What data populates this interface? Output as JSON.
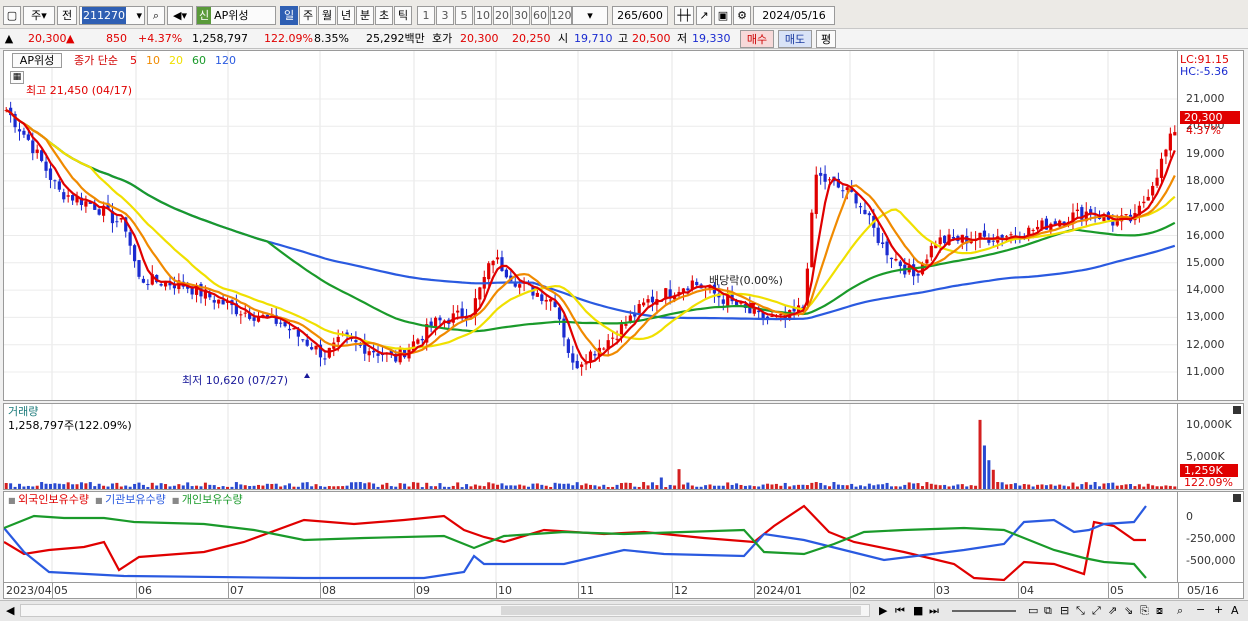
{
  "toolbar": {
    "market": "주",
    "period_type": "전",
    "code": "211270",
    "name": "AP위성",
    "credit_badge": "신",
    "periods": [
      "일",
      "주",
      "월",
      "년",
      "분",
      "초",
      "틱"
    ],
    "intervals": [
      "1",
      "3",
      "5",
      "10",
      "20",
      "30",
      "60",
      "120"
    ],
    "count": "265",
    "count_total": "/600",
    "date": "2024/05/16"
  },
  "quote": {
    "price": "20,300",
    "arrow": "▲",
    "change": "850",
    "change_pct": "+4.37%",
    "volume": "1,258,797",
    "volume_ratio": "122.09%",
    "turnover": "8.35%",
    "amount": "25,292백만",
    "ask_label": "호가",
    "ask": "20,300",
    "bid": "20,250",
    "open_label": "시",
    "open": "19,710",
    "high_label": "고",
    "high": "20,500",
    "low_label": "저",
    "low": "19,330",
    "buy": "매수",
    "sell": "매도",
    "eval": "평"
  },
  "price_pane": {
    "title": "AP위성",
    "legend_prefix": "종가 단순",
    "ma": [
      {
        "label": "5",
        "color": "#e00000"
      },
      {
        "label": "10",
        "color": "#f08a00"
      },
      {
        "label": "20",
        "color": "#f0e000"
      },
      {
        "label": "60",
        "color": "#1a9a2a"
      },
      {
        "label": "120",
        "color": "#2a5ae0"
      }
    ],
    "lc": "LC:91.15",
    "hc": "HC:-5.36",
    "high_note": "최고 21,450 (04/17)",
    "low_note": "최저 10,620 (07/27)",
    "div_note": "배당락(0.00%)",
    "yticks": [
      "21,000",
      "20,000",
      "19,000",
      "18,000",
      "17,000",
      "16,000",
      "15,000",
      "14,000",
      "13,000",
      "12,000",
      "11,000"
    ],
    "last_price": "20,300",
    "last_pct": "4.37%"
  },
  "volume_pane": {
    "title": "거래량",
    "value": "1,258,797주(122.09%)",
    "yticks": [
      "10,000K",
      "5,000K"
    ],
    "last": "1,259K",
    "last_pct": "122.09%"
  },
  "investor_pane": {
    "series": [
      {
        "label": "외국인보유수량",
        "color": "#e00000"
      },
      {
        "label": "기관보유수량",
        "color": "#2a5ae0"
      },
      {
        "label": "개인보유수량",
        "color": "#1a9a2a"
      }
    ],
    "yticks": [
      "0",
      "-250,000",
      "-500,000"
    ]
  },
  "xaxis": {
    "labels": [
      "2023/04",
      "05",
      "06",
      "07",
      "08",
      "09",
      "10",
      "11",
      "12",
      "2024/01",
      "02",
      "03",
      "04",
      "05"
    ],
    "end_label": "05/16"
  }
}
